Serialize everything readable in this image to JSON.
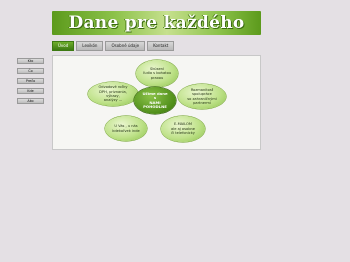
{
  "header": {
    "title": "Dane pre každého"
  },
  "nav": {
    "tabs": [
      {
        "label": "Úvod"
      },
      {
        "label": "Lexikón"
      },
      {
        "label": "Osobné údaje"
      },
      {
        "label": "Kontakt"
      }
    ]
  },
  "sidebar": {
    "items": [
      {
        "label": "Kto"
      },
      {
        "label": "Čo"
      },
      {
        "label": "Prečo"
      },
      {
        "label": "Kde"
      },
      {
        "label": "Ako"
      }
    ]
  },
  "diagram": {
    "center": "Učíme dane\ns\nNAMI\nPOHODLNE",
    "top": "Skúsení\nľudia s bohatou\npraxou",
    "left": "Odvodové ročky\nDPH, priznania, výkazy,\nanalýzy ...",
    "right": "Rozmanitosť\nspolupráce\nso zahraničnými\npartnermi",
    "bottom_left": "U Vás , u nás\nkdekoľvek inde",
    "bottom_right": "E-MAILOM\nale aj osobne\nči telefonicky"
  }
}
